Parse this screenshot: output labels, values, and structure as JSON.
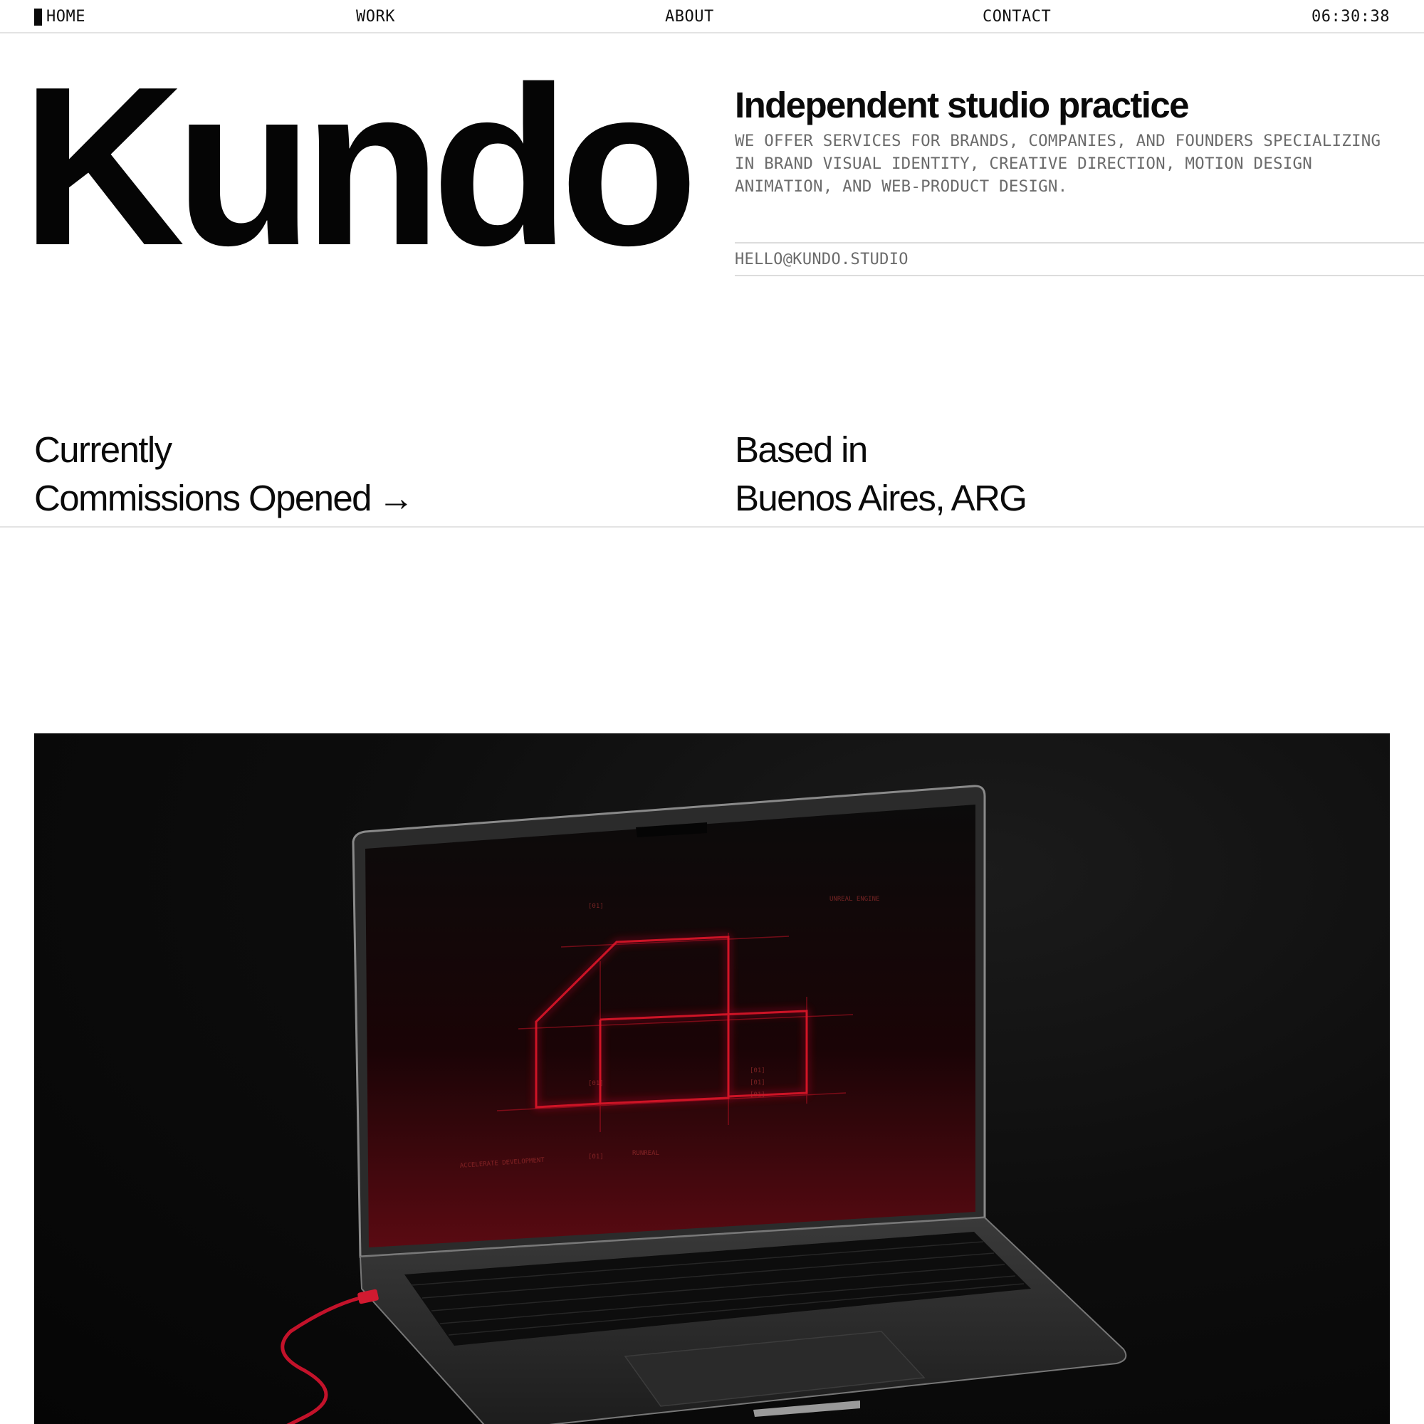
{
  "nav": {
    "home": "HOME",
    "work": "WORK",
    "about": "ABOUT",
    "contact": "CONTACT",
    "clock": "06:30:38"
  },
  "hero": {
    "logo": "Kundo",
    "title": "Independent studio practice",
    "description": "WE OFFER SERVICES FOR BRANDS, COMPANIES, AND FOUNDERS SPECIALIZING IN BRAND VISUAL IDENTITY, CREATIVE DIRECTION, MOTION DESIGN ANIMATION, AND WEB-PRODUCT DESIGN.",
    "email": "HELLO@KUNDO.STUDIO"
  },
  "info": {
    "status_line1": "Currently",
    "status_line2": "Commissions Opened",
    "status_arrow": "→",
    "location_line1": "Based in",
    "location_line2": "Buenos Aires, ARG"
  },
  "media": {
    "screen_labels": [
      "[01]",
      "[01]",
      "[01]",
      "[01]",
      "[01]",
      "[01]",
      "RUNREAL",
      "ACCELERATE DEVELOPMENT",
      "UNREAL ENGINE"
    ]
  },
  "colors": {
    "accent_red": "#e0142a",
    "text": "#0a0a0a",
    "muted": "#6b6b6b",
    "rule": "#e3e3e3"
  }
}
